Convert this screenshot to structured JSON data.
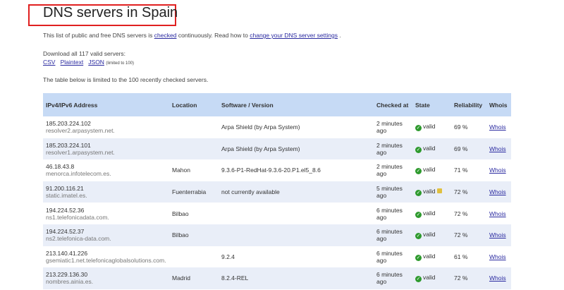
{
  "title": "DNS servers in Spain",
  "intro": {
    "t1": "This list of public and free DNS servers is ",
    "link1": "checked",
    "t2": " continuously. Read how to ",
    "link2": "change your DNS server settings",
    "t3": " ."
  },
  "download": {
    "label": "Download all 117 valid servers:",
    "csv": "CSV",
    "plaintext": "Plaintext",
    "json": "JSON",
    "json_note": "(limited to 100)"
  },
  "limit_note": "The table below is limited to the 100 recently checked servers.",
  "table": {
    "headers": [
      "IPv4/IPv6 Address",
      "Location",
      "Software / Version",
      "Checked at",
      "State",
      "Reliability",
      "Whois"
    ],
    "rows": [
      {
        "ip": "185.203.224.102",
        "host": "resolver2.arpasystem.net.",
        "location": "",
        "software": "Arpa Shield (by Arpa System)",
        "checked": "2 minutes ago",
        "state": "valid",
        "reliability": "69 %",
        "whois": "Whois",
        "dnssec": false
      },
      {
        "ip": "185.203.224.101",
        "host": "resolver1.arpasystem.net.",
        "location": "",
        "software": "Arpa Shield (by Arpa System)",
        "checked": "2 minutes ago",
        "state": "valid",
        "reliability": "69 %",
        "whois": "Whois",
        "dnssec": false
      },
      {
        "ip": "46.18.43.8",
        "host": "menorca.infotelecom.es.",
        "location": "Mahon",
        "software": "9.3.6-P1-RedHat-9.3.6-20.P1.el5_8.6",
        "checked": "2 minutes ago",
        "state": "valid",
        "reliability": "71 %",
        "whois": "Whois",
        "dnssec": false
      },
      {
        "ip": "91.200.116.21",
        "host": "static.imatel.es.",
        "location": "Fuenterrabia",
        "software": "not currently available",
        "checked": "5 minutes ago",
        "state": "valid",
        "reliability": "72 %",
        "whois": "Whois",
        "dnssec": true
      },
      {
        "ip": "194.224.52.36",
        "host": "ns1.telefonicadata.com.",
        "location": "Bilbao",
        "software": "",
        "checked": "6 minutes ago",
        "state": "valid",
        "reliability": "72 %",
        "whois": "Whois",
        "dnssec": false
      },
      {
        "ip": "194.224.52.37",
        "host": "ns2.telefonica-data.com.",
        "location": "Bilbao",
        "software": "",
        "checked": "6 minutes ago",
        "state": "valid",
        "reliability": "72 %",
        "whois": "Whois",
        "dnssec": false
      },
      {
        "ip": "213.140.41.226",
        "host": "gsemiatic1.net.telefonicaglobalsolutions.com.",
        "location": "",
        "software": "9.2.4",
        "checked": "6 minutes ago",
        "state": "valid",
        "reliability": "61 %",
        "whois": "Whois",
        "dnssec": false
      },
      {
        "ip": "213.229.136.30",
        "host": "nombres.ainia.es.",
        "location": "Madrid",
        "software": "8.2.4-REL",
        "checked": "6 minutes ago",
        "state": "valid",
        "reliability": "72 %",
        "whois": "Whois",
        "dnssec": false
      }
    ]
  }
}
